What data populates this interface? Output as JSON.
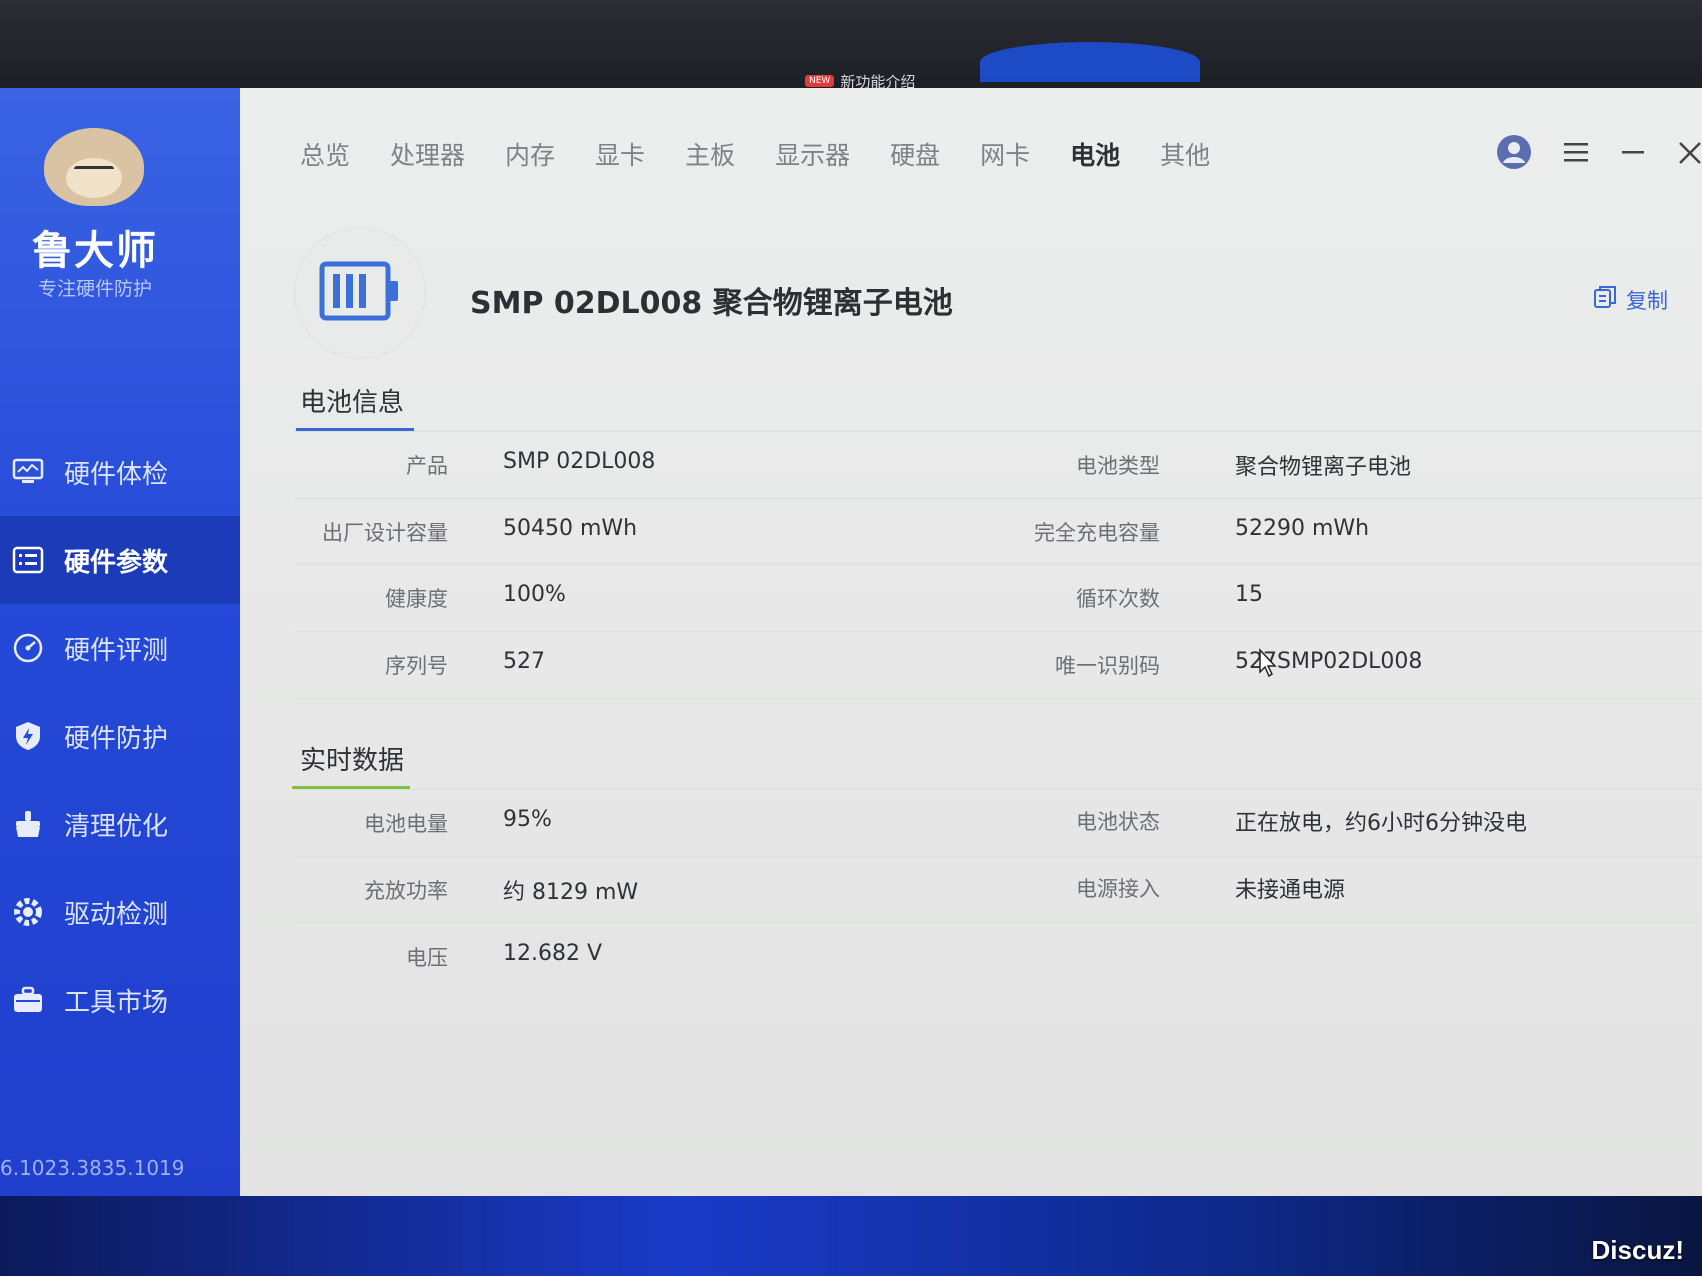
{
  "screen": {
    "notice_tag": "NEW",
    "notice_text": "新功能介绍",
    "watermark": "Discuz!"
  },
  "sidebar": {
    "brand": "鲁大师",
    "slogan": "专注硬件防护",
    "version": "6.1023.3835.1019",
    "items": [
      {
        "label": "硬件体检",
        "icon": "monitor-icon"
      },
      {
        "label": "硬件参数",
        "icon": "list-icon"
      },
      {
        "label": "硬件评测",
        "icon": "gauge-icon"
      },
      {
        "label": "硬件防护",
        "icon": "shield-icon"
      },
      {
        "label": "清理优化",
        "icon": "broom-icon"
      },
      {
        "label": "驱动检测",
        "icon": "gear-icon"
      },
      {
        "label": "工具市场",
        "icon": "toolbox-icon"
      }
    ],
    "active_index": 1
  },
  "topnav": {
    "tabs": [
      "总览",
      "处理器",
      "内存",
      "显卡",
      "主板",
      "显示器",
      "硬盘",
      "网卡",
      "电池",
      "其他"
    ],
    "active": "电池"
  },
  "device": {
    "title": "SMP 02DL008 聚合物锂离子电池",
    "copy_label": "复制"
  },
  "battery_info": {
    "title": "电池信息",
    "rows": [
      {
        "left_label": "产品",
        "left_value": "SMP 02DL008",
        "right_label": "电池类型",
        "right_value": "聚合物锂离子电池"
      },
      {
        "left_label": "出厂设计容量",
        "left_value": "50450 mWh",
        "right_label": "完全充电容量",
        "right_value": "52290 mWh"
      },
      {
        "left_label": "健康度",
        "left_value": "100%",
        "right_label": "循环次数",
        "right_value": "15"
      },
      {
        "left_label": "序列号",
        "left_value": "527",
        "right_label": "唯一识别码",
        "right_value": "527SMP02DL008"
      }
    ]
  },
  "realtime": {
    "title": "实时数据",
    "rows": [
      {
        "left_label": "电池电量",
        "left_value": "95%",
        "right_label": "电池状态",
        "right_value": "正在放电，约6小时6分钟没电"
      },
      {
        "left_label": "充放功率",
        "left_value": "约 8129 mW",
        "right_label": "电源接入",
        "right_value": "未接通电源"
      },
      {
        "left_label": "电压",
        "left_value": "12.682 V"
      }
    ]
  },
  "colors": {
    "sidebar": "#2549d8",
    "accent_blue": "#3867d6",
    "accent_green": "#7cc142"
  }
}
